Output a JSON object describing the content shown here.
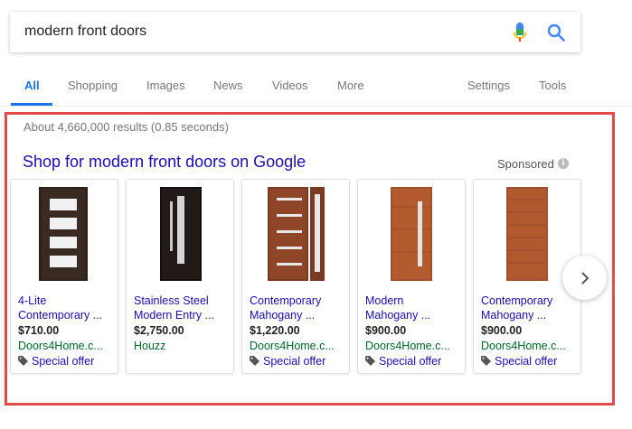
{
  "search": {
    "query": "modern front doors",
    "mic_icon": "microphone-icon",
    "search_icon": "search-icon"
  },
  "tabs": {
    "items": [
      {
        "label": "All",
        "active": true
      },
      {
        "label": "Shopping"
      },
      {
        "label": "Images"
      },
      {
        "label": "News"
      },
      {
        "label": "Videos"
      },
      {
        "label": "More"
      }
    ],
    "settings": "Settings",
    "tools": "Tools",
    "accent_color": "#1a73e8"
  },
  "results": {
    "count_text": "About 4,660,000 results (0.85 seconds)"
  },
  "shopping": {
    "title": "Shop for modern front doors on Google",
    "sponsored": "Sponsored",
    "info_icon": "i",
    "products": [
      {
        "name_line1": "4-Lite",
        "name_line2": "Contemporary ...",
        "price": "$710.00",
        "seller": "Doors4Home.c...",
        "offer": "Special offer"
      },
      {
        "name_line1": "Stainless Steel",
        "name_line2": "Modern Entry ...",
        "price": "$2,750.00",
        "seller": "Houzz",
        "offer": ""
      },
      {
        "name_line1": "Contemporary",
        "name_line2": "Mahogany ...",
        "price": "$1,220.00",
        "seller": "Doors4Home.c...",
        "offer": "Special offer"
      },
      {
        "name_line1": "Modern",
        "name_line2": "Mahogany ...",
        "price": "$900.00",
        "seller": "Doors4Home.c...",
        "offer": "Special offer"
      },
      {
        "name_line1": "Contemporary",
        "name_line2": "Mahogany ...",
        "price": "$900.00",
        "seller": "Doors4Home.c...",
        "offer": "Special offer"
      }
    ],
    "link_color": "#1a0dab",
    "seller_color": "#006621",
    "highlight_color": "#e24a4a"
  }
}
